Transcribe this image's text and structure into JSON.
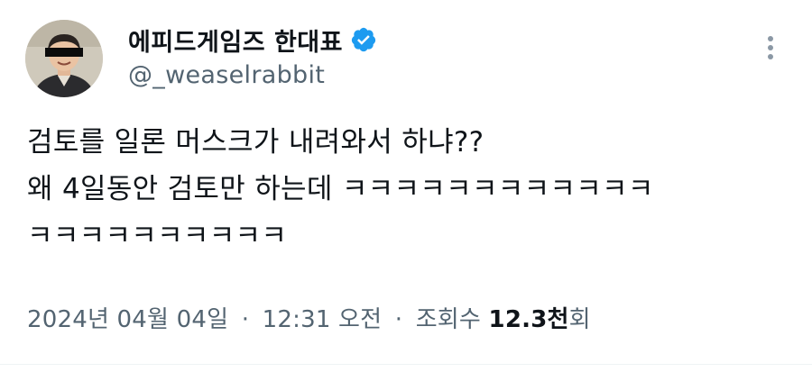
{
  "author": {
    "display_name": "에피드게임즈 한대표",
    "handle": "@_weaselrabbit",
    "verified": true,
    "verified_color": "#1d9bf0",
    "avatar_icon": "profile-photo"
  },
  "tweet": {
    "lines": [
      "검토를 일론 머스크가 내려와서 하냐??",
      "왜 4일동안 검토만 하는데 ㅋㅋㅋㅋㅋㅋㅋㅋㅋㅋㅋㅋ",
      "ㅋㅋㅋㅋㅋㅋㅋㅋㅋㅋ"
    ]
  },
  "meta": {
    "date": "2024년 04월 04일",
    "separator": "·",
    "time": "12:31 오전",
    "views_label": "조회수",
    "views_count": "12.3천",
    "views_suffix": "회"
  },
  "icons": {
    "more": "more-vertical-icon",
    "verified": "verified-badge-icon"
  }
}
